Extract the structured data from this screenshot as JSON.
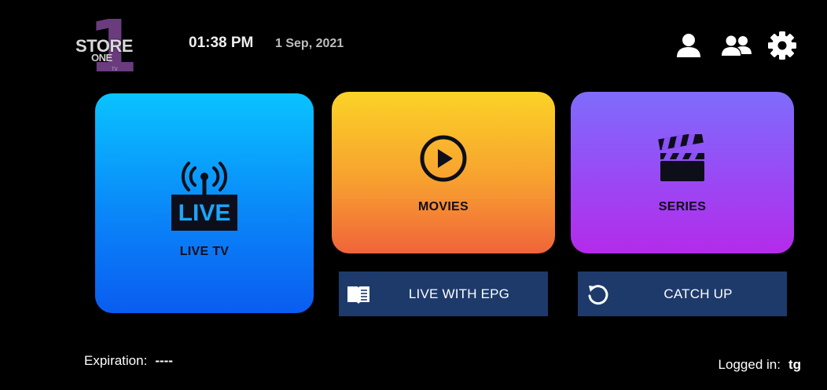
{
  "logo": {
    "numeral": "1",
    "store": "STORE",
    "one": "ONE",
    "tv": "TV"
  },
  "header": {
    "time": "01:38 PM",
    "date": "1 Sep, 2021"
  },
  "icons": {
    "user": "user-icon",
    "users": "users-icon",
    "settings": "gear-icon"
  },
  "tiles": {
    "live_badge": "LIVE",
    "live": "LIVE TV",
    "movies": "MOVIES",
    "series": "SERIES"
  },
  "bars": {
    "epg": "LIVE WITH EPG",
    "catchup": "CATCH UP"
  },
  "footer": {
    "expiration_label": "Expiration:",
    "expiration_value": "----",
    "logged_label": "Logged in:",
    "logged_value": "tg"
  },
  "colors": {
    "background": "#000000",
    "live": "#0a86f8",
    "movies": "#f7a02f",
    "series": "#9a48f4",
    "bar": "#1d3a6b"
  }
}
